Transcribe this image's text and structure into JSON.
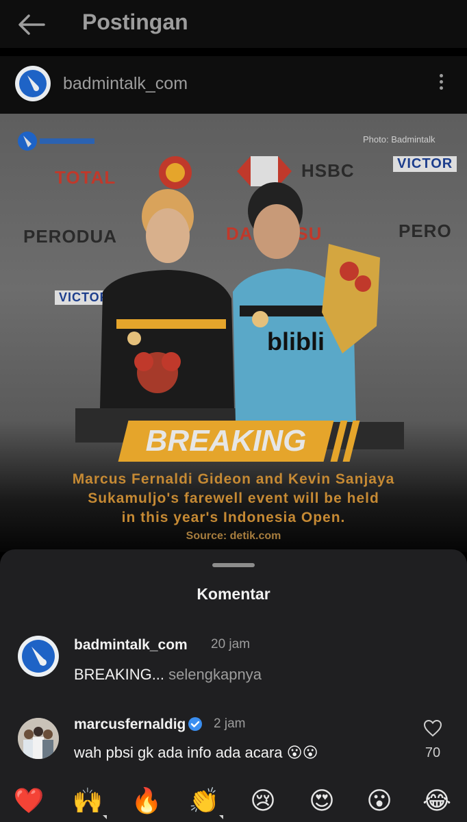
{
  "header": {
    "title": "Postingan",
    "back_icon": "arrow-left-icon"
  },
  "account": {
    "username": "badmintalk_com",
    "menu_icon": "more-vertical-icon"
  },
  "post": {
    "photo_credit": "Photo: Badmintalk",
    "sponsors": [
      "TOTAL",
      "HSBC",
      "VICTOR",
      "PERODUA",
      "DAIHATSU",
      "PERO",
      "VICTOR"
    ],
    "jersey_text": "blibli",
    "banner": "BREAKING",
    "headline_lines": [
      "Marcus Fernaldi Gideon and Kevin Sanjaya",
      "Sukamuljo's farewell event will be held",
      "in this year's Indonesia Open."
    ],
    "source": "Source: detik.com",
    "accent_color": "#e5a52b"
  },
  "comments_sheet": {
    "title": "Komentar",
    "comments": [
      {
        "username": "badmintalk_com",
        "time": "20 jam",
        "text": "BREAKING...",
        "more": " selengkapnya"
      },
      {
        "username": "marcusfernaldig",
        "verified": true,
        "time": "2 jam",
        "text": "wah pbsi gk ada info ada acara 😮😮",
        "likes": "70"
      }
    ],
    "quick_reactions": [
      "❤️",
      "🙌",
      "🔥",
      "👏",
      "😢",
      "😍",
      "😮",
      "😂"
    ]
  }
}
